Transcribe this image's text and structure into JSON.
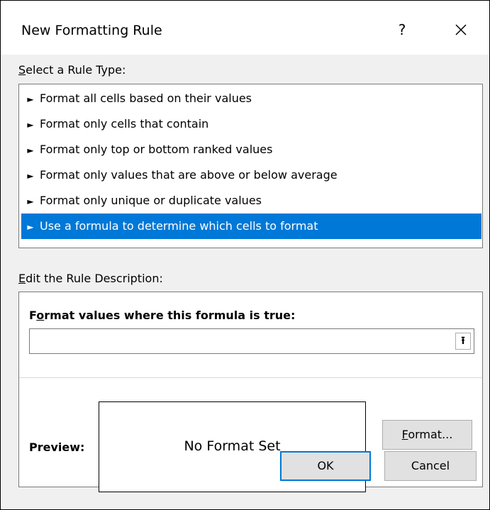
{
  "dialog": {
    "title": "New Formatting Rule",
    "help_label": "?",
    "close_icon": "close-icon"
  },
  "rule_type": {
    "label_underlined": "S",
    "label_rest": "elect a Rule Type:",
    "bullet_glyph": "►",
    "items": [
      {
        "label": "Format all cells based on their values",
        "selected": false
      },
      {
        "label": "Format only cells that contain",
        "selected": false
      },
      {
        "label": "Format only top or bottom ranked values",
        "selected": false
      },
      {
        "label": "Format only values that are above or below average",
        "selected": false
      },
      {
        "label": "Format only unique or duplicate values",
        "selected": false
      },
      {
        "label": "Use a formula to determine which cells to format",
        "selected": true
      }
    ]
  },
  "description": {
    "label_underlined": "E",
    "label_rest": "dit the Rule Description:",
    "formula_label_first": "F",
    "formula_label_underlined": "o",
    "formula_label_rest": "rmat values where this formula is true:",
    "formula_value": "",
    "collapse_glyph": "⭱",
    "preview_label": "Preview:",
    "preview_text": "No Format Set",
    "format_button_underlined": "F",
    "format_button_rest": "ormat..."
  },
  "footer": {
    "ok_label": "OK",
    "cancel_label": "Cancel"
  },
  "colors": {
    "selection": "#0078d7",
    "dialog_bg": "#f0f0f0",
    "button_bg": "#e1e1e1"
  }
}
